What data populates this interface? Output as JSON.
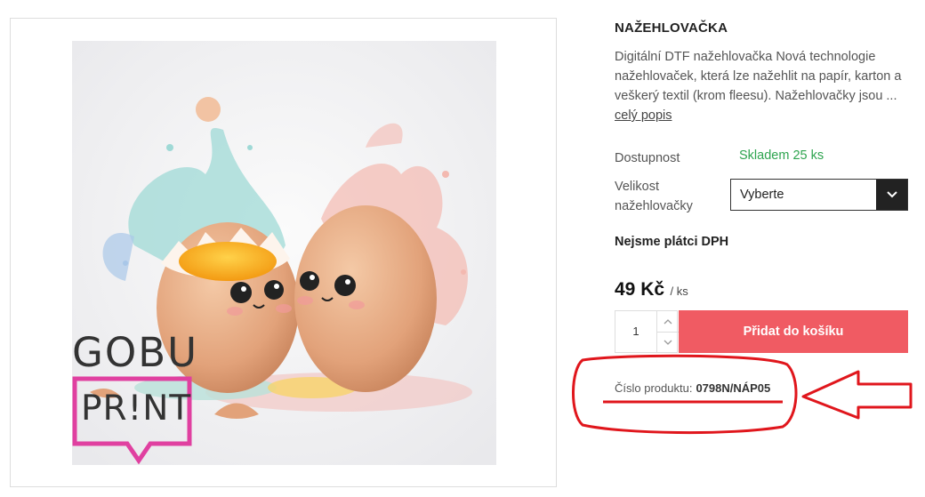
{
  "product": {
    "title": "NAŽEHLOVAČKA",
    "description": "Digitální DTF nažehlovačka  Nová technologie\nnažehlovaček, která lze nažehlit na papír, karton a\nveškerý textil (krom fleesu).  Nažehlovačky jsou ...",
    "more_link": "celý popis",
    "availability_label": "Dostupnost",
    "availability_value": "Skladem 25 ks",
    "size_label": "Velikost\nnažehlovačky",
    "size_select_value": "Vyberte",
    "vat_note": "Nejsme plátci DPH",
    "price": "49 Kč",
    "price_unit": "/ ks",
    "quantity": "1",
    "add_to_cart": "Přidat do košíku",
    "code_label": "Číslo produktu:",
    "code_value": "0798N/NÁP05"
  },
  "logo": {
    "line1": "GOBU",
    "line2": "PR!NT"
  },
  "colors": {
    "accent": "#f05b63",
    "in_stock": "#2ea44f",
    "annotation": "#e0161c",
    "logo_pink": "#e040a0"
  },
  "icons": [
    "chevron-down-icon",
    "chevron-up-icon",
    "red-arrow-annotation",
    "red-ellipse-annotation"
  ]
}
